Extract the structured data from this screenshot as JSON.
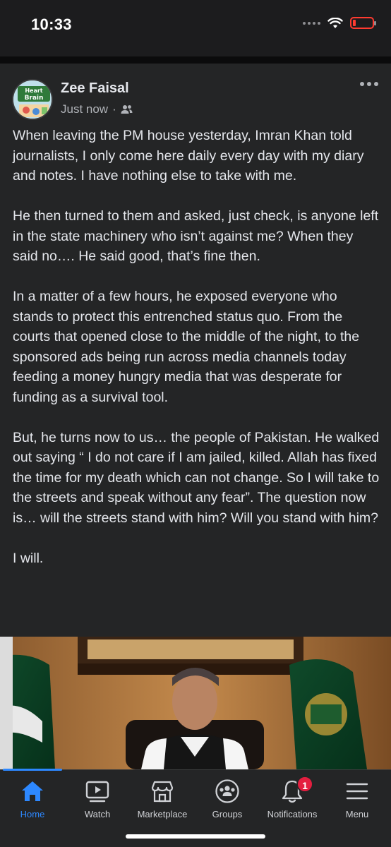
{
  "status_bar": {
    "time": "10:33",
    "icons": [
      "signal-icon",
      "wifi-icon",
      "battery-icon"
    ],
    "battery_color": "#ff3b30"
  },
  "post": {
    "author": "Zee Faisal",
    "timestamp": "Just now",
    "separator": "·",
    "audience_icon": "friends-icon",
    "avatar_text": [
      "Heart",
      "Brain"
    ],
    "paragraphs": [
      "When leaving the PM house yesterday, Imran Khan told journalists, I only come here daily every day with my diary and notes. I have nothing else to take with me.",
      "He then turned to them and asked, just check, is anyone left in the state machinery who isn’t against me? When they said no…. He said good, that’s fine then.",
      "In a matter of a few hours, he exposed everyone who stands to protect this entrenched status quo. From the courts that opened close to the middle of the night, to the sponsored ads being run across media channels today feeding a money hungry media that was desperate for funding as a survival tool.",
      "But, he turns now to us… the people of Pakistan.  He walked out saying “ I do not care if I am jailed, killed. Allah has fixed the time for my death which can not change. So I will take to the streets and speak without any fear”. The question now is… will the streets stand with him? Will you stand with him?",
      "I will."
    ]
  },
  "bottom_nav": {
    "items": [
      {
        "label": "Home",
        "icon": "home-icon",
        "active": true
      },
      {
        "label": "Watch",
        "icon": "watch-icon",
        "active": false
      },
      {
        "label": "Marketplace",
        "icon": "marketplace-icon",
        "active": false
      },
      {
        "label": "Groups",
        "icon": "groups-icon",
        "active": false
      },
      {
        "label": "Notifications",
        "icon": "bell-icon",
        "active": false,
        "badge": "1"
      },
      {
        "label": "Menu",
        "icon": "menu-icon",
        "active": false
      }
    ],
    "accent_color": "#2d88ff",
    "badge_color": "#e41e3f"
  }
}
